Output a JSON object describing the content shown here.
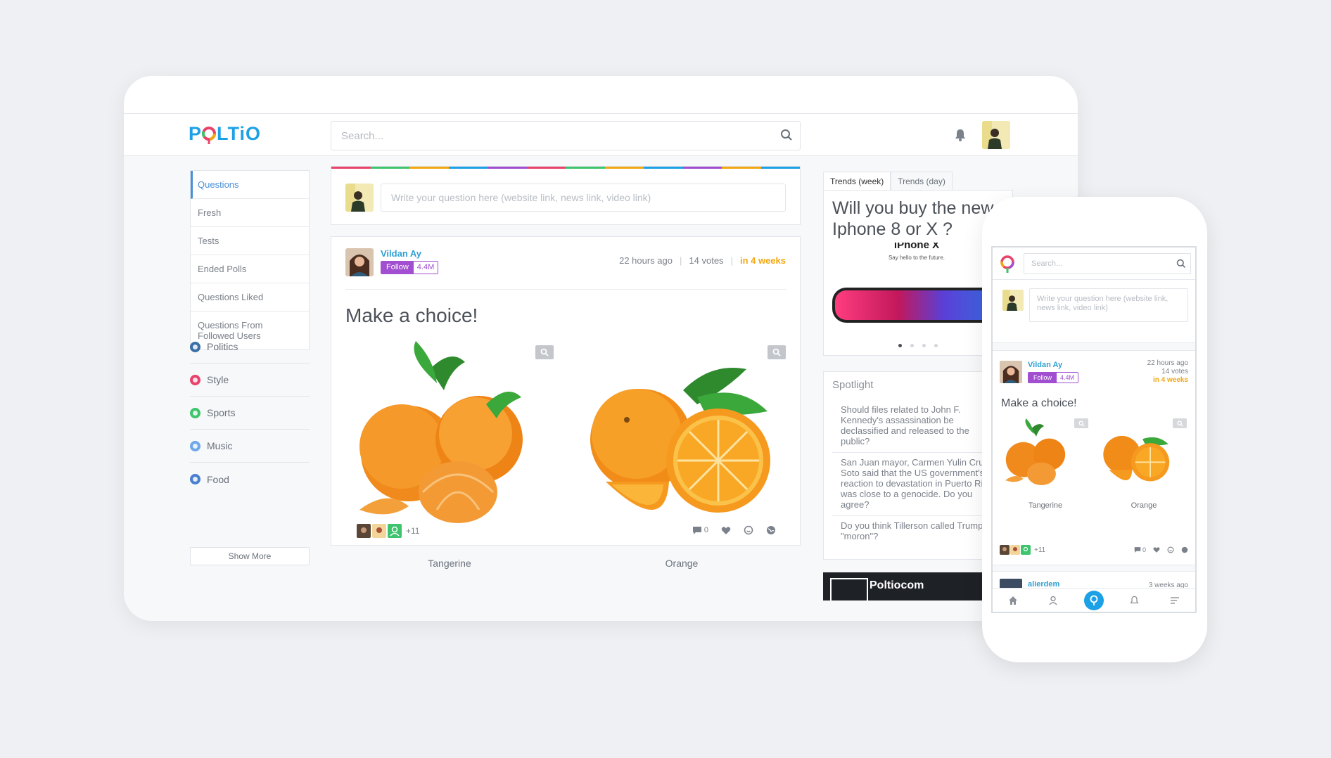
{
  "app": {
    "logo_text": "POLTiO"
  },
  "header": {
    "search_placeholder": "Search..."
  },
  "sidebar": {
    "items": [
      {
        "label": "Questions"
      },
      {
        "label": "Fresh"
      },
      {
        "label": "Tests"
      },
      {
        "label": "Ended Polls"
      },
      {
        "label": "Questions Liked"
      },
      {
        "label": "Questions From Followed Users"
      }
    ],
    "categories": [
      {
        "label": "Politics",
        "color": "#3a6ea5"
      },
      {
        "label": "Style",
        "color": "#e8436b"
      },
      {
        "label": "Sports",
        "color": "#3ec46d"
      },
      {
        "label": "Music",
        "color": "#6fa8e8"
      },
      {
        "label": "Food",
        "color": "#4a7fd0"
      }
    ],
    "show_more": "Show More"
  },
  "composer": {
    "placeholder": "Write your question here (website link, news link, video link)"
  },
  "post": {
    "user": "Vildan Ay",
    "follow_label": "Follow",
    "follow_count": "4.4M",
    "time": "22 hours ago",
    "votes": "14 votes",
    "due": "in 4 weeks",
    "title": "Make a choice!",
    "choices": [
      {
        "label": "Tangerine"
      },
      {
        "label": "Orange"
      }
    ],
    "more_voters": "+11",
    "comments": "0"
  },
  "trends": {
    "tabs": [
      "Trends (week)",
      "Trends (day)"
    ],
    "question": "Will you buy the new Iphone 8 or X ?",
    "image_title": "iPhone X",
    "image_subtitle": "Say hello to the future."
  },
  "spotlight": {
    "title": "Spotlight",
    "items": [
      "Should files related to John F. Kennedy's assassination be declassified and released to the public?",
      "San Juan mayor, Carmen Yulin Cruz Soto said that the US government's reaction to devastation in Puerto Rico was close to a genocide. Do you agree?",
      "Do you think Tillerson called Trump \"moron\"?"
    ]
  },
  "video": {
    "title": "Poltiocom"
  },
  "mobile": {
    "search_placeholder": "Search...",
    "composer_placeholder": "Write your question here (website link, news link, video link)",
    "post": {
      "user": "Vildan Ay",
      "follow_label": "Follow",
      "follow_count": "4.4M",
      "time": "22 hours ago",
      "votes": "14 votes",
      "due": "in 4 weeks",
      "title": "Make a choice!",
      "choices": [
        {
          "label": "Tangerine"
        },
        {
          "label": "Orange"
        }
      ],
      "more_voters": "+11",
      "comments": "0"
    },
    "next_post": {
      "user": "alierdem",
      "time": "3 weeks ago"
    }
  },
  "colors": {
    "accent": "#4a90d9",
    "username": "#2f9fd3",
    "follow": "#a14fd0",
    "due": "#f3a712",
    "rainbow": [
      "#e8436b",
      "#3ec46d",
      "#f3a712",
      "#1da1e6",
      "#a14fd0",
      "#e8436b",
      "#3ec46d",
      "#f3a712",
      "#1da1e6",
      "#a14fd0",
      "#f3a712",
      "#1da1e6"
    ]
  }
}
